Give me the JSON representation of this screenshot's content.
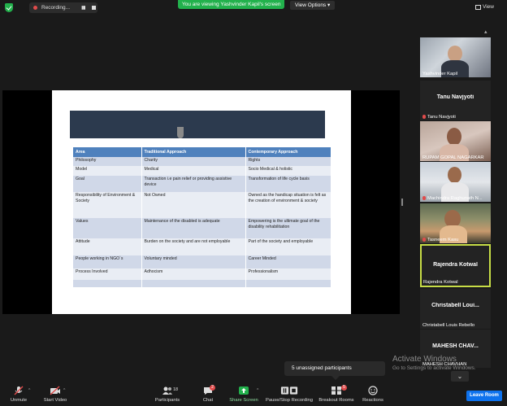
{
  "topbar": {
    "recording_label": "Recording...",
    "viewing_banner": "You are viewing Yashvinder Kapil's screen",
    "view_options_label": "View Options ▾",
    "view_label": "View"
  },
  "slide": {
    "headers": [
      "Area",
      "Traditional Approach",
      "Contemporary Approach"
    ],
    "rows": [
      [
        "Philosophy",
        "Charity",
        "Rights"
      ],
      [
        "Model",
        "Medical",
        "Socio Medical & holistic"
      ],
      [
        "Goal",
        "Transaction i.e pain relief or providing assistive device",
        "Transformation of life cycle basis"
      ],
      [
        "Responsibility of Environment & Society",
        "Not Owned",
        "Owned as the handicap situation is felt as the  creation of environment & society"
      ],
      [
        "Values",
        "Maintenance of the disabled is adequate",
        "Empowering is the ultimate goal of the disability rehabilitation"
      ],
      [
        "Attitude",
        "Burden on the society and are not employable",
        "Part of the society and employable"
      ],
      [
        "People working in NGO`s",
        "Voluntary minded",
        "Career Minded"
      ],
      [
        "Process Involved",
        "Adhocism",
        "Professionalism"
      ],
      [
        "",
        "",
        ""
      ]
    ]
  },
  "gallery": {
    "tiles": [
      {
        "name": "Yashvinder Kapil",
        "big": ""
      },
      {
        "name": "Tanu Navjyoti",
        "big": "Tanu Navjyoti"
      },
      {
        "name": "RUPAM GOPAL NAGARKAR",
        "big": ""
      },
      {
        "name": "Machindra Raghunath N...",
        "big": ""
      },
      {
        "name": "Tasneem Kasu",
        "big": ""
      },
      {
        "name": "Rajendra Kotwal",
        "big": "Rajendra Kotwal"
      },
      {
        "name": "Christabell Louis Rebello",
        "big": "Christabell  Loui..."
      },
      {
        "name": "MAHESH CHAVHAN",
        "big": "MAHESH   CHAV..."
      }
    ]
  },
  "watermark": {
    "title": "Activate Windows",
    "subtitle": "Go to Settings to activate Windows."
  },
  "breakout_tooltip": "5 unassigned participants",
  "toolbar": {
    "unmute": "Unmute",
    "start_video": "Start Video",
    "participants": "Participants",
    "participants_count": "18",
    "chat": "Chat",
    "chat_badge": "2",
    "share_screen": "Share Screen",
    "pause_recording": "Pause/Stop Recording",
    "breakout_rooms": "Breakout Rooms",
    "breakout_badge": "5",
    "reactions": "Reactions",
    "leave_room": "Leave Room"
  },
  "colors": {
    "accent_green": "#22b14c",
    "leave_blue": "#0e72ed",
    "table_header": "#4f81bd",
    "active_speaker": "#c7dd46"
  }
}
